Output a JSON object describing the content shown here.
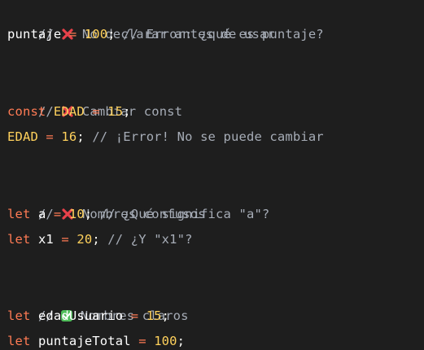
{
  "code": {
    "line1": {
      "comment_prefix": "// ",
      "comment_text": " No declarar antes de usar"
    },
    "line2": {
      "ident": "puntaje",
      "op": "=",
      "number": "100",
      "punc": ";",
      "comment": "// Error: ¿qué es puntaje?"
    },
    "line4": {
      "comment_prefix": "// ",
      "comment_text": " Cambiar const"
    },
    "line5": {
      "keyword": "const",
      "ident": "EDAD",
      "op": "=",
      "number": "15",
      "punc": ";"
    },
    "line6": {
      "ident": "EDAD",
      "op": "=",
      "number": "16",
      "punc": ";",
      "comment": "// ¡Error! No se puede cambiar"
    },
    "line8": {
      "comment_prefix": "// ",
      "comment_text": " Nombres confusos"
    },
    "line9": {
      "keyword": "let",
      "ident": "a",
      "op": "=",
      "number": "10",
      "punc": ";",
      "comment": "// ¿Qué significa \"a\"?"
    },
    "line10": {
      "keyword": "let",
      "ident": "x1",
      "op": "=",
      "number": "20",
      "punc": ";",
      "comment": "// ¿Y \"x1\"?"
    },
    "line12": {
      "comment_prefix": "// ",
      "comment_text": " Nombres claros"
    },
    "line13": {
      "keyword": "let",
      "ident": "edadUsuario",
      "op": "=",
      "number": "15",
      "punc": ";"
    },
    "line14": {
      "keyword": "let",
      "ident": "puntajeTotal",
      "op": "=",
      "number": "100",
      "punc": ";"
    }
  },
  "icons": {
    "cross": "cross-mark-icon",
    "check": "check-mark-icon"
  },
  "colors": {
    "background": "#1e1e1e",
    "comment": "#a6acb6",
    "keyword": "#ff7b54",
    "number": "#ffd15c",
    "identifier": "#ffffff",
    "cross": "#e8414a",
    "check": "#4fbe5a"
  }
}
